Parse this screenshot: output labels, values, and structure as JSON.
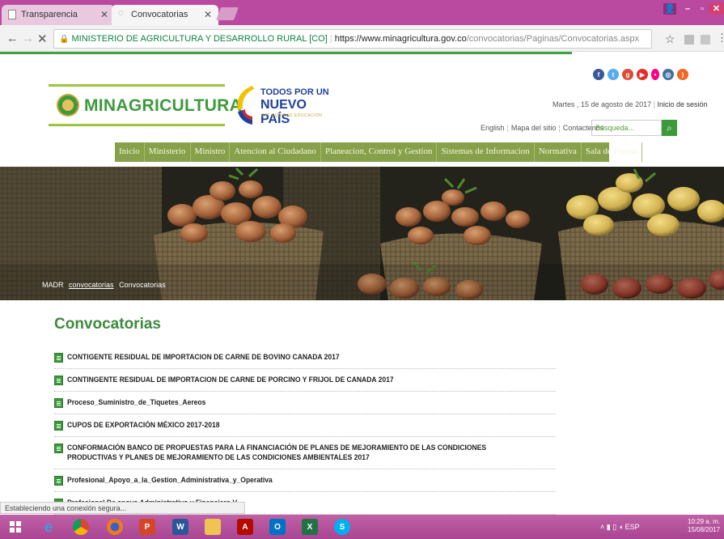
{
  "browser": {
    "tabs": [
      {
        "label": "Transparencia",
        "active": false
      },
      {
        "label": "Convocatorias",
        "active": true
      }
    ],
    "address": {
      "site_identity": "MINISTERIO DE AGRICULTURA Y DESARROLLO RURAL [CO]",
      "url_host": "https://www.minagricultura.gov.co",
      "url_path": "/convocatorias/Paginas/Convocatorias.aspx"
    },
    "loading_progress": 0.79,
    "status_text": "Estableciendo una conexión segura..."
  },
  "header": {
    "logo_text": "MINAGRICULTURA",
    "gov_logo": {
      "line1": "TODOS POR UN",
      "line2": "NUEVO PAÍS",
      "line3": "PAZ  EQUIDAD  EDUCACIÓN"
    },
    "date": "Martes , 15 de agosto de 2017",
    "login": "Inicio de sesión",
    "top_links": [
      "English",
      "Mapa del sitio",
      "Contactenos"
    ],
    "search_placeholder": "Búsqueda...",
    "social_icons": [
      "facebook-icon",
      "twitter-icon",
      "googleplus-icon",
      "youtube-icon",
      "flickr-icon",
      "instagram-icon",
      "rss-icon"
    ]
  },
  "nav": {
    "items": [
      "Inicio",
      "Ministerio",
      "Ministro",
      "Atencion al Ciudadano",
      "Planeacion, Control y Gestion",
      "Sistemas de Informacion",
      "Normativa",
      "Sala de Prensa"
    ]
  },
  "breadcrumb": [
    "MADR",
    "convocatorias",
    "Convocatorias"
  ],
  "main": {
    "title": "Convocatorias",
    "items": [
      "CONTIGENTE RESIDUAL DE IMPORTACION DE CARNE DE BOVINO CANADA 2017",
      "CONTINGENTE RESIDUAL DE IMPORTACION DE CARNE DE PORCINO Y FRIJOL DE CANADA 2017",
      "Proceso_Suministro_de_Tiquetes_Aereos",
      "CUPOS DE EXPORTACIÓN MÉXICO 2017-2018",
      "CONFORMACIÓN BANCO DE PROPUESTAS PARA LA FINANCIACIÓN DE PLANES DE MEJORAMIENTO DE LAS CONDICIONES PRODUCTIVAS Y PLANES DE MEJORAMIENTO DE LAS CONDICIONES AMBIENTALES 2017",
      "Profesional_Apoyo_a_la_Gestion_Administrativa_y_Operativa",
      "Profesional De apoyo Administrativo y Financiero V"
    ]
  },
  "taskbar": {
    "tray_lang": "ESP",
    "clock_time": "10:29 a. m.",
    "clock_date": "15/08/2017"
  },
  "colors": {
    "brand_green": "#3d9a3b",
    "nav_green": "#86a14a",
    "chrome_magenta": "#b94aa0"
  }
}
